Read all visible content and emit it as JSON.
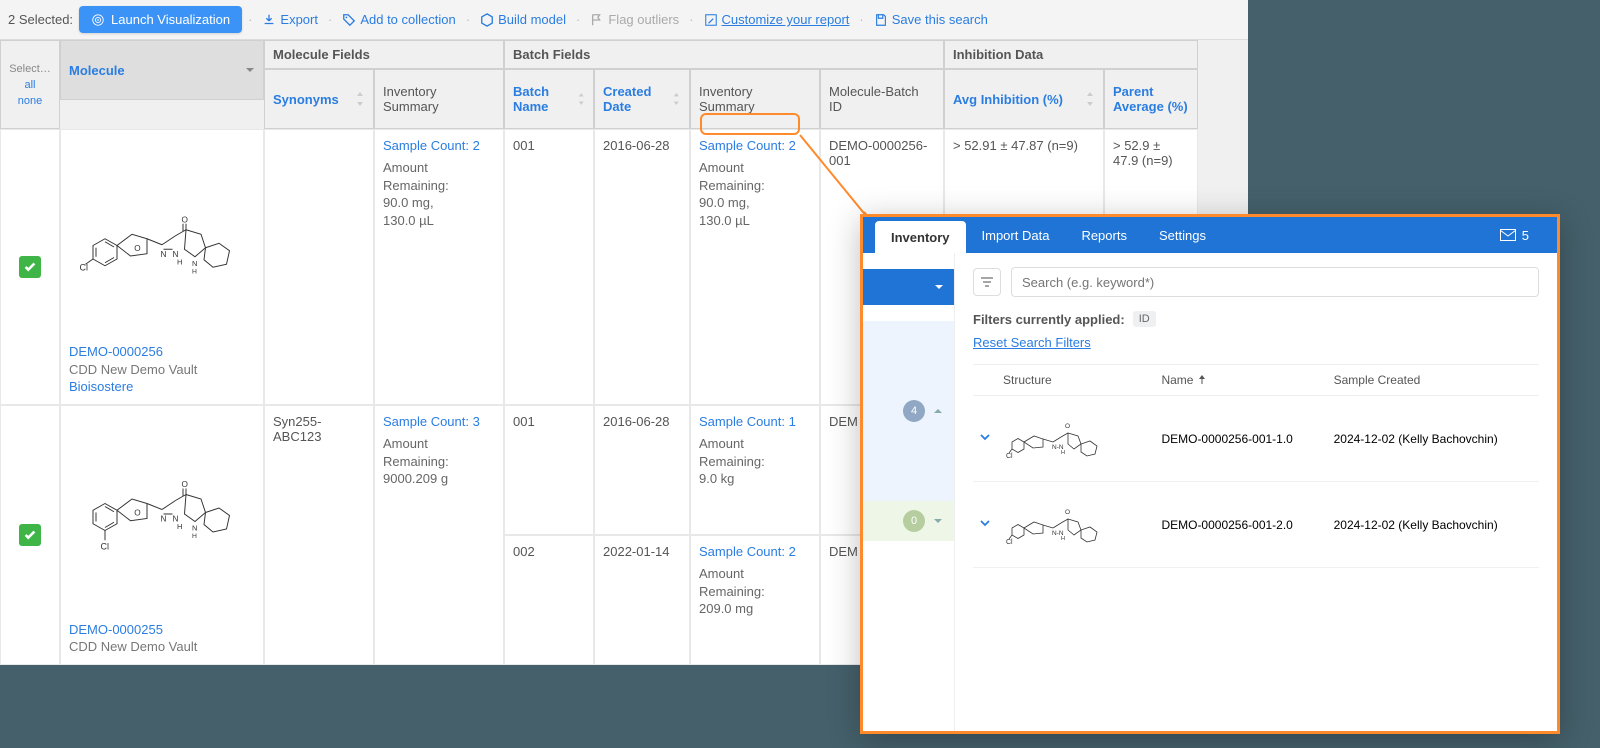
{
  "toolbar": {
    "selected_label": "2 Selected:",
    "launch": "Launch Visualization",
    "export": "Export",
    "add_collection": "Add to collection",
    "build_model": "Build model",
    "flag_outliers": "Flag outliers",
    "customize": "Customize your report",
    "save_search": "Save this search"
  },
  "select_col": {
    "label": "Select…",
    "all": "all",
    "none": "none"
  },
  "groups": {
    "molecule_fields": "Molecule Fields",
    "batch_fields": "Batch Fields",
    "inhibition_data": "Inhibition Data"
  },
  "columns": {
    "molecule": "Molecule",
    "synonyms": "Synonyms",
    "inv_summary_m": "Inventory Summary",
    "batch_name": "Batch Name",
    "created_date": "Created Date",
    "inv_summary_b": "Inventory Summary",
    "mbid": "Molecule-Batch ID",
    "avg_inh": "Avg Inhibition (%)",
    "parent_avg": "Parent Average (%)"
  },
  "rows": [
    {
      "id": "DEMO-0000256",
      "vault": "CDD New Demo Vault",
      "tag": "Bioisostere",
      "synonyms": "",
      "batches": [
        {
          "inv_m": {
            "sample": "Sample Count: 2",
            "amount_label": "Amount Remaining:",
            "amount_1": "90.0 mg,",
            "amount_2": "130.0 µL"
          },
          "batch_name": "001",
          "created_date": "2016-06-28",
          "inv_b": {
            "sample": "Sample Count: 2",
            "amount_label": "Amount Remaining:",
            "amount_1": "90.0 mg,",
            "amount_2": "130.0 µL"
          },
          "mbid": "DEMO-0000256-001",
          "avg_inh": "> 52.91 ± 47.87 (n=9)",
          "parent_avg": "> 52.9 ± 47.9 (n=9)"
        }
      ]
    },
    {
      "id": "DEMO-0000255",
      "vault": "CDD New Demo Vault",
      "tag": "",
      "synonyms": "Syn255-ABC123",
      "batches": [
        {
          "inv_m": {
            "sample": "Sample Count: 3",
            "amount_label": "Amount Remaining:",
            "amount_1": "9000.209 g",
            "amount_2": ""
          },
          "batch_name": "001",
          "created_date": "2016-06-28",
          "inv_b": {
            "sample": "Sample Count: 1",
            "amount_label": "Amount Remaining:",
            "amount_1": "9.0 kg",
            "amount_2": ""
          },
          "mbid": "DEM",
          "avg_inh": "",
          "parent_avg": ""
        },
        {
          "inv_m": {
            "sample": "",
            "amount_label": "",
            "amount_1": "",
            "amount_2": ""
          },
          "batch_name": "002",
          "created_date": "2022-01-14",
          "inv_b": {
            "sample": "Sample Count: 2",
            "amount_label": "Amount Remaining:",
            "amount_1": "209.0 mg",
            "amount_2": ""
          },
          "mbid": "DEM",
          "avg_inh": "",
          "parent_avg": ""
        }
      ]
    }
  ],
  "popover": {
    "tabs": {
      "inventory": "Inventory",
      "import": "Import Data",
      "reports": "Reports",
      "settings": "Settings"
    },
    "envelope_count": "5",
    "sidebar": {
      "count1": "4",
      "count2": "0"
    },
    "search_placeholder": "Search (e.g. keyword*)",
    "filters_label": "Filters currently applied:",
    "chip_id": "ID",
    "reset": "Reset Search Filters",
    "table": {
      "headers": {
        "structure": "Structure",
        "name": "Name",
        "created": "Sample Created"
      },
      "rows": [
        {
          "name": "DEMO-0000256-001-1.0",
          "created": "2024-12-02 (Kelly Bachovchin)"
        },
        {
          "name": "DEMO-0000256-001-2.0",
          "created": "2024-12-02 (Kelly Bachovchin)"
        }
      ]
    }
  }
}
